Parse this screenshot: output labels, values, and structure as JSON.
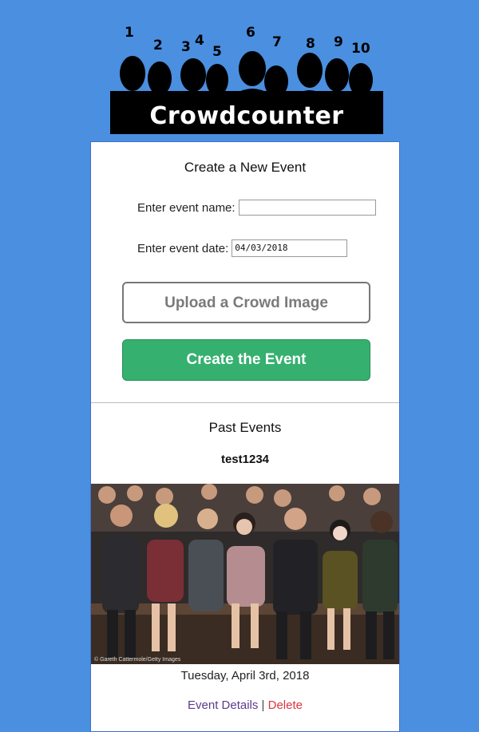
{
  "app": {
    "title": "Crowdcounter",
    "logo_numbers": [
      "1",
      "2",
      "3",
      "4",
      "5",
      "6",
      "7",
      "8",
      "9",
      "10"
    ]
  },
  "create": {
    "heading": "Create a New Event",
    "name_label": "Enter event name:",
    "name_value": "",
    "date_label": "Enter event date:",
    "date_value": "04/03/2018",
    "upload_label": "Upload a Crowd Image",
    "create_label": "Create the Event"
  },
  "past": {
    "heading": "Past Events",
    "events": [
      {
        "name": "test1234",
        "photo_credit": "© Gareth Cattermole/Getty Images",
        "date": "Tuesday, April 3rd, 2018",
        "details_label": "Event Details",
        "separator": "|",
        "delete_label": "Delete"
      }
    ]
  },
  "colors": {
    "background": "#4a8fe0",
    "create_button": "#36b06f",
    "delete_link": "#d9363e",
    "details_link": "#5b3b8c"
  }
}
